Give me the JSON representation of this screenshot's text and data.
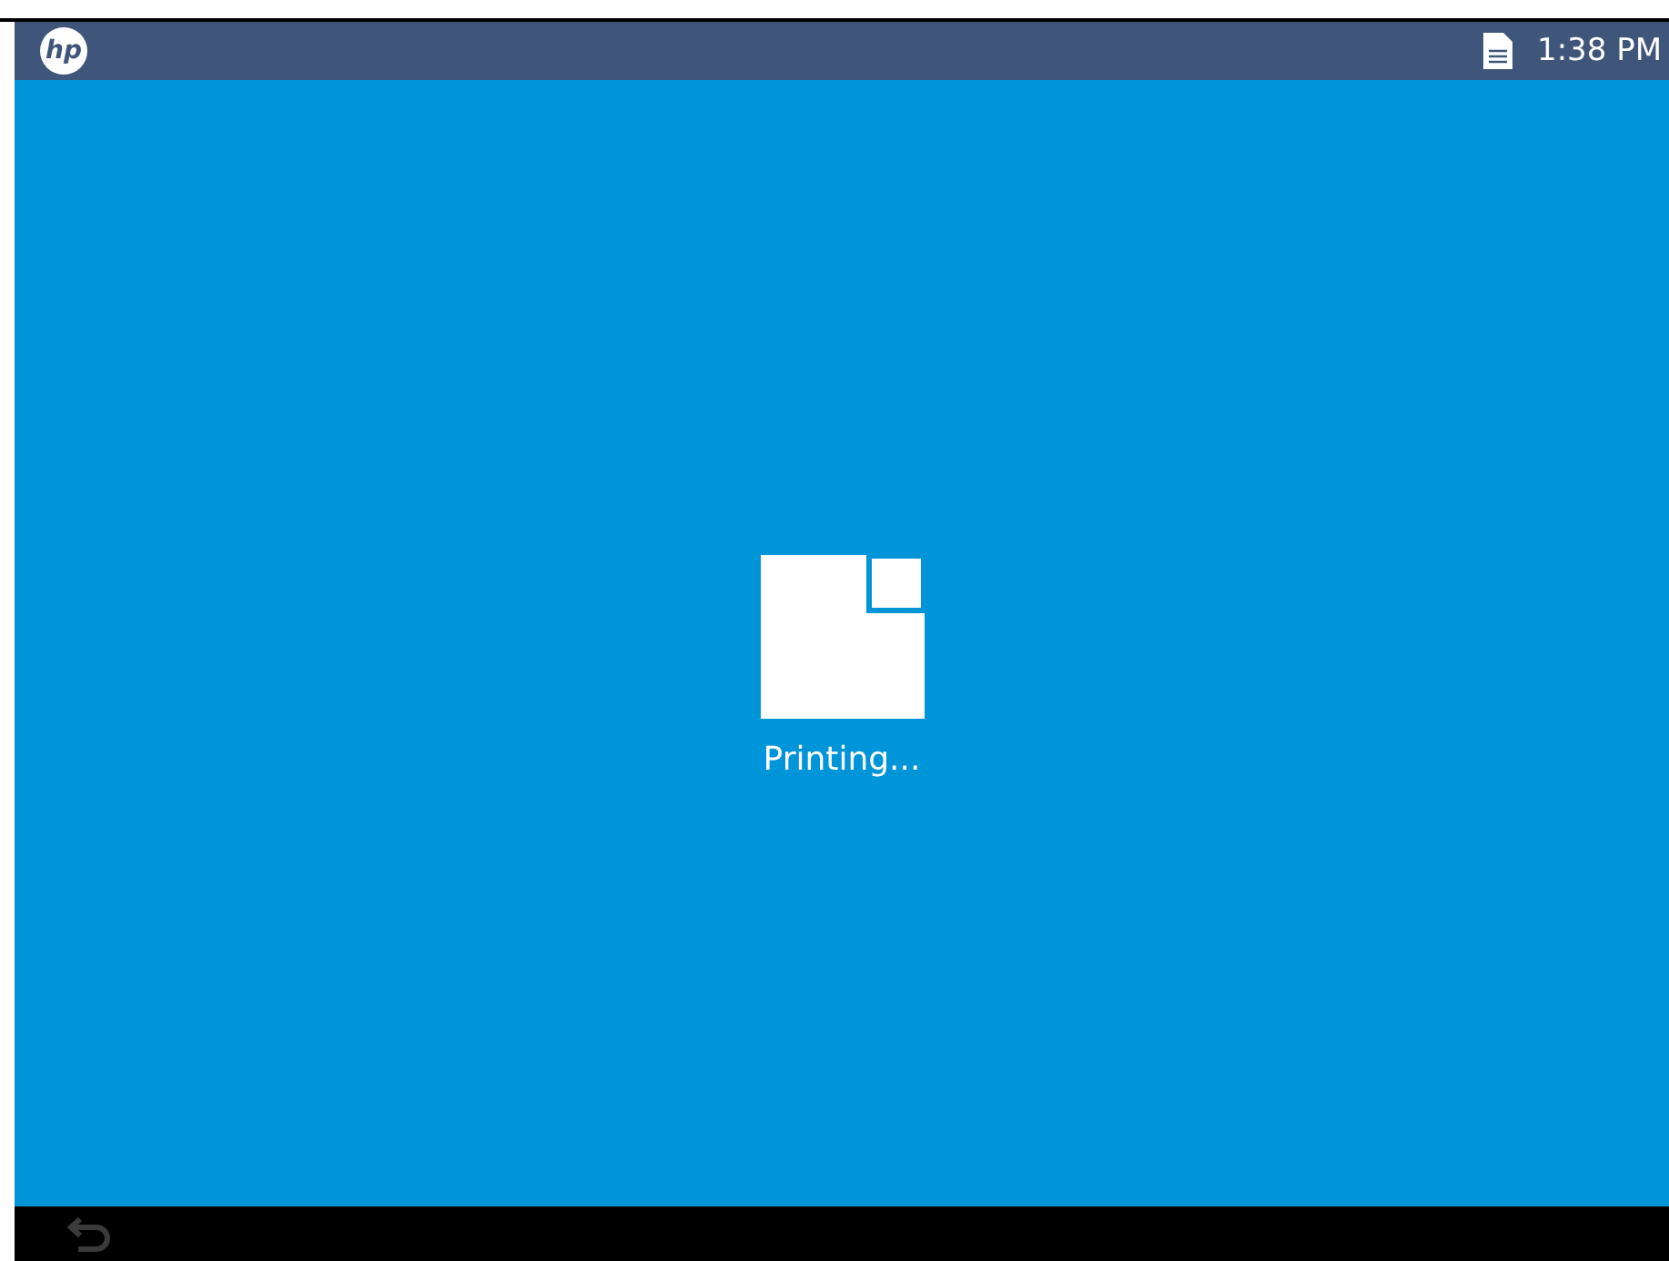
{
  "status_bar": {
    "logo": "hp",
    "time": "1:38 PM"
  },
  "job": {
    "status": "Printing..."
  }
}
